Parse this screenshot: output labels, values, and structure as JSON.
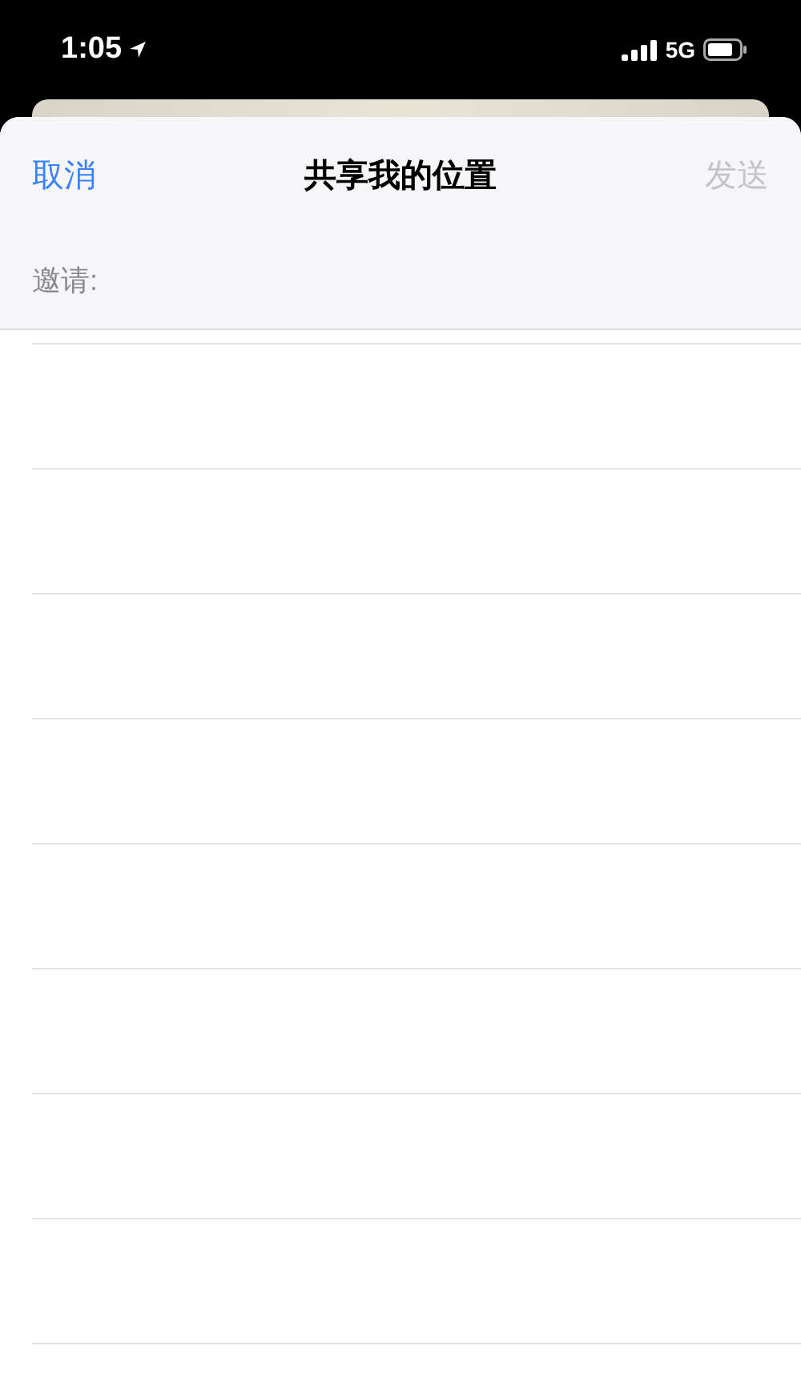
{
  "status_bar": {
    "time": "1:05",
    "network": "5G"
  },
  "nav_bar": {
    "cancel": {
      "label": "取消",
      "disabled": false
    },
    "title": "共享我的位置",
    "send": {
      "label": "发送",
      "disabled": true
    }
  },
  "invite_field": {
    "label": "邀请:"
  }
}
